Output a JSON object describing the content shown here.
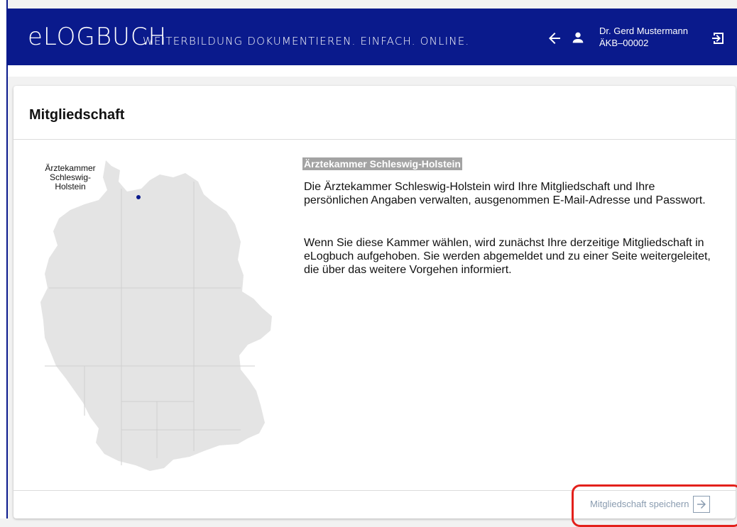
{
  "header": {
    "logo": "eLOGBUCH",
    "tagline": "WEITERBILDUNG DOKUMENTIEREN. EINFACH. ONLINE.",
    "user_name": "Dr. Gerd Mustermann",
    "user_id": "ÄKB–00002",
    "icons": {
      "back": "arrow-left-icon",
      "user": "person-icon",
      "logout": "logout-icon"
    }
  },
  "card": {
    "title": "Mitgliedschaft",
    "map_label": "Ärztekammer Schleswig-Holstein",
    "info": {
      "heading": "Ärztekammer Schleswig-Holstein",
      "paragraph_1": "Die Ärztekammer Schleswig-Holstein wird Ihre Mitgliedschaft und Ihre persönlichen Angaben verwalten, ausgenommen E-Mail-Adresse und Passwort.",
      "paragraph_2": "Wenn Sie diese Kammer wählen, wird zunächst Ihre derzeitige Mitgliedschaft in eLogbuch aufgehoben. Sie werden abgemeldet und zu einer Seite weitergeleitet, die über das weitere Vorgehen informiert."
    },
    "save_button": "Mitgliedschaft speichern"
  },
  "colors": {
    "brand": "#0a1a8c",
    "map_fill": "#e4e4e4",
    "map_marker": "#0a1a8c",
    "highlight": "#e3201b",
    "button_text": "#8a9cb0"
  }
}
